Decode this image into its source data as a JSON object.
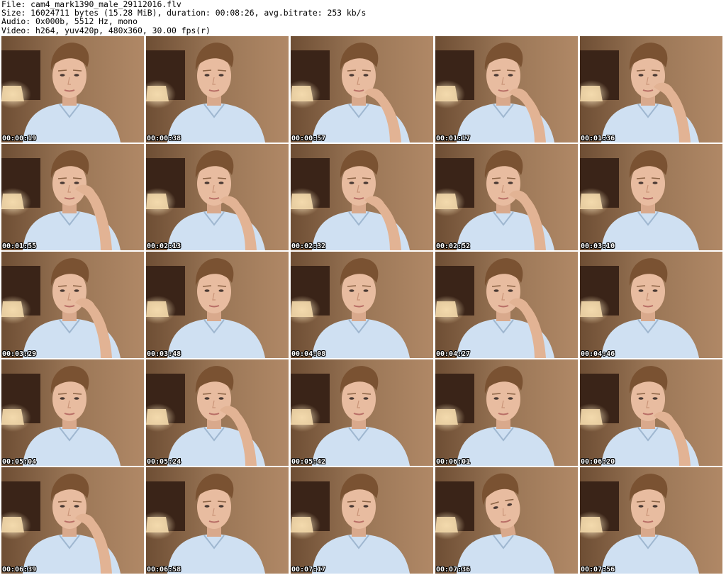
{
  "info": {
    "file": "File: cam4_mark1390_male_29112016.flv",
    "size": "Size: 16024711 bytes (15.28 MiB), duration: 00:08:26, avg.bitrate: 253 kb/s",
    "audio": "Audio: 0x000b, 5512 Hz, mono",
    "video": "Video: h264, yuv420p, 480x360, 30.00 fps(r)"
  },
  "thumbnails": [
    {
      "time": "00:00:19",
      "pose": "neutral"
    },
    {
      "time": "00:00:38",
      "pose": "neutral"
    },
    {
      "time": "00:00:57",
      "pose": "hand-chin"
    },
    {
      "time": "00:01:17",
      "pose": "hand-chin"
    },
    {
      "time": "00:01:36",
      "pose": "hand-mouth"
    },
    {
      "time": "00:01:55",
      "pose": "hand-cheek"
    },
    {
      "time": "00:02:13",
      "pose": "hand-chin"
    },
    {
      "time": "00:02:32",
      "pose": "hand-chin"
    },
    {
      "time": "00:02:52",
      "pose": "hand-mouth"
    },
    {
      "time": "00:03:10",
      "pose": "neutral"
    },
    {
      "time": "00:03:29",
      "pose": "hand-mouth"
    },
    {
      "time": "00:03:48",
      "pose": "neutral"
    },
    {
      "time": "00:04:08",
      "pose": "neutral"
    },
    {
      "time": "00:04:27",
      "pose": "hand-mouth"
    },
    {
      "time": "00:04:46",
      "pose": "neutral"
    },
    {
      "time": "00:05:04",
      "pose": "neutral"
    },
    {
      "time": "00:05:24",
      "pose": "hand-mouth"
    },
    {
      "time": "00:05:42",
      "pose": "neutral"
    },
    {
      "time": "00:06:01",
      "pose": "neutral"
    },
    {
      "time": "00:06:20",
      "pose": "hand-chin"
    },
    {
      "time": "00:06:39",
      "pose": "hand-mouth"
    },
    {
      "time": "00:06:58",
      "pose": "neutral"
    },
    {
      "time": "00:07:17",
      "pose": "neutral"
    },
    {
      "time": "00:07:36",
      "pose": "head-tilt"
    },
    {
      "time": "00:07:56",
      "pose": "neutral"
    }
  ],
  "colors": {
    "wall": "#9a7656",
    "wall_dark": "#6e4e34",
    "headboard": "#3a2418",
    "lamp": "#f2d7a8",
    "shirt": "#cfe0f2",
    "skin": "#e8bca0",
    "hair": "#7a5232"
  }
}
